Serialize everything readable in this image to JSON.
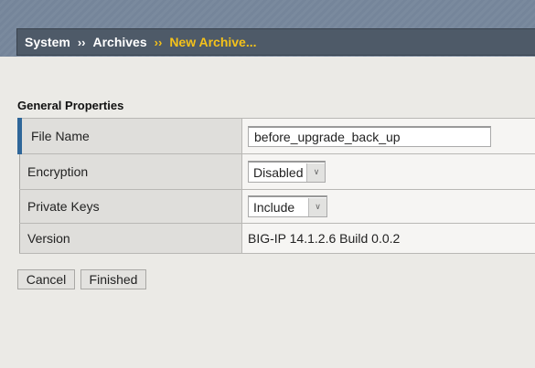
{
  "breadcrumb": {
    "items": [
      "System",
      "Archives"
    ],
    "separator": "››",
    "current": "New Archive..."
  },
  "section_title": "General Properties",
  "form": {
    "file_name": {
      "label": "File Name",
      "value": "before_upgrade_back_up"
    },
    "encryption": {
      "label": "Encryption",
      "value": "Disabled"
    },
    "private_keys": {
      "label": "Private Keys",
      "value": "Include"
    },
    "version": {
      "label": "Version",
      "value": "BIG-IP 14.1.2.6 Build 0.0.2"
    }
  },
  "buttons": {
    "cancel": "Cancel",
    "finished": "Finished"
  },
  "colors": {
    "accent": "#2f6699",
    "breadcrumb_current": "#f5c21a",
    "breadcrumb_bar": "#4e5a68"
  }
}
